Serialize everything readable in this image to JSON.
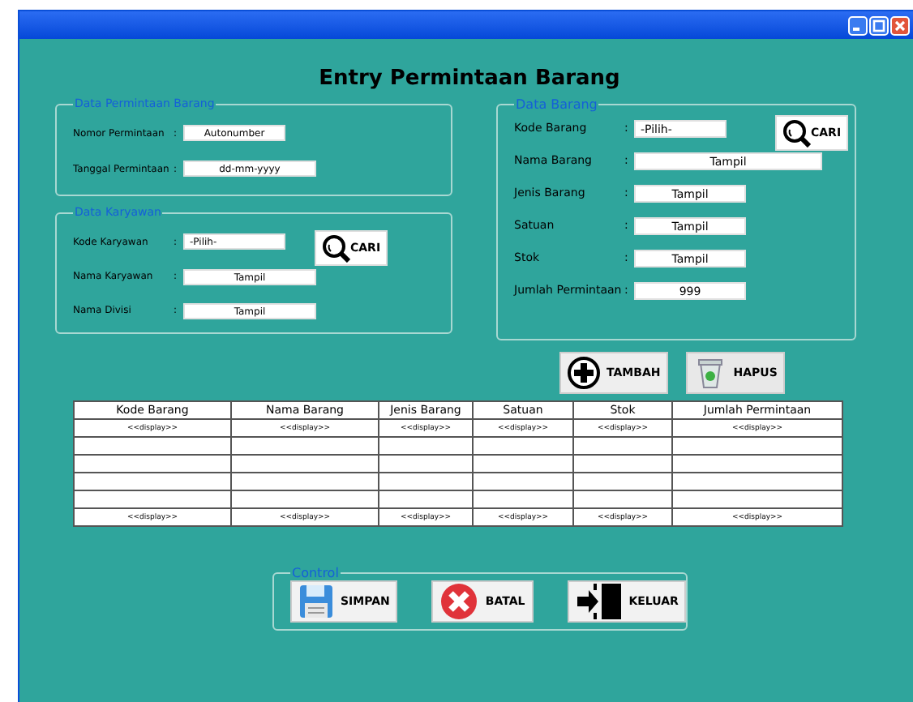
{
  "window": {
    "controls": [
      {
        "kind": "minimize"
      },
      {
        "kind": "maximize"
      },
      {
        "kind": "close"
      }
    ]
  },
  "heading": "Entry Permintaan Barang",
  "data_permintaan": {
    "legend": "Data Permintaan Barang",
    "fields": [
      {
        "label": "Nomor Permintaan",
        "separator": ":",
        "value": "Autonumber",
        "kind": "text"
      },
      {
        "label": "Tanggal Permintaan",
        "separator": ":",
        "value": "dd-mm-yyyy",
        "kind": "text"
      }
    ]
  },
  "data_karyawan": {
    "legend": "Data Karyawan",
    "search_button": "CARI",
    "fields": [
      {
        "label": "Kode Karyawan",
        "separator": ":",
        "value": "-Pilih-",
        "kind": "select"
      },
      {
        "label": "Nama Karyawan",
        "separator": ":",
        "value": "Tampil",
        "kind": "text"
      },
      {
        "label": "Nama Divisi",
        "separator": ":",
        "value": "Tampil",
        "kind": "text"
      }
    ]
  },
  "data_barang": {
    "legend": "Data Barang",
    "search_button": "CARI",
    "fields": [
      {
        "label": "Kode Barang",
        "separator": ":",
        "value": "-Pilih-",
        "kind": "select"
      },
      {
        "label": "Nama Barang",
        "separator": ":",
        "value": "Tampil",
        "kind": "text"
      },
      {
        "label": "Jenis Barang",
        "separator": ":",
        "value": "Tampil",
        "kind": "text"
      },
      {
        "label": "Satuan",
        "separator": ":",
        "value": "Tampil",
        "kind": "text"
      },
      {
        "label": "Stok",
        "separator": ":",
        "value": "Tampil",
        "kind": "text"
      },
      {
        "label": "Jumlah Permintaan",
        "separator": ":",
        "value": "999",
        "kind": "text"
      }
    ]
  },
  "item_buttons": [
    {
      "label": "TAMBAH",
      "kind": "add"
    },
    {
      "label": "HAPUS",
      "kind": "delete"
    }
  ],
  "table": {
    "columns": [
      "Kode Barang",
      "Nama Barang",
      "Jenis Barang",
      "Satuan",
      "Stok",
      "Jumlah Permintaan"
    ],
    "rows": [
      [
        "<<display>>",
        "<<display>>",
        "<<display>>",
        "<<display>>",
        "<<display>>",
        "<<display>>"
      ],
      [],
      [],
      [],
      [],
      [
        "<<display>>",
        "<<display>>",
        "<<display>>",
        "<<display>>",
        "<<display>>",
        "<<display>>"
      ]
    ]
  },
  "control": {
    "legend": "Control",
    "buttons": [
      {
        "label": "SIMPAN",
        "kind": "save"
      },
      {
        "label": "BATAL",
        "kind": "cancel"
      },
      {
        "label": "KELUAR",
        "kind": "exit"
      }
    ]
  }
}
